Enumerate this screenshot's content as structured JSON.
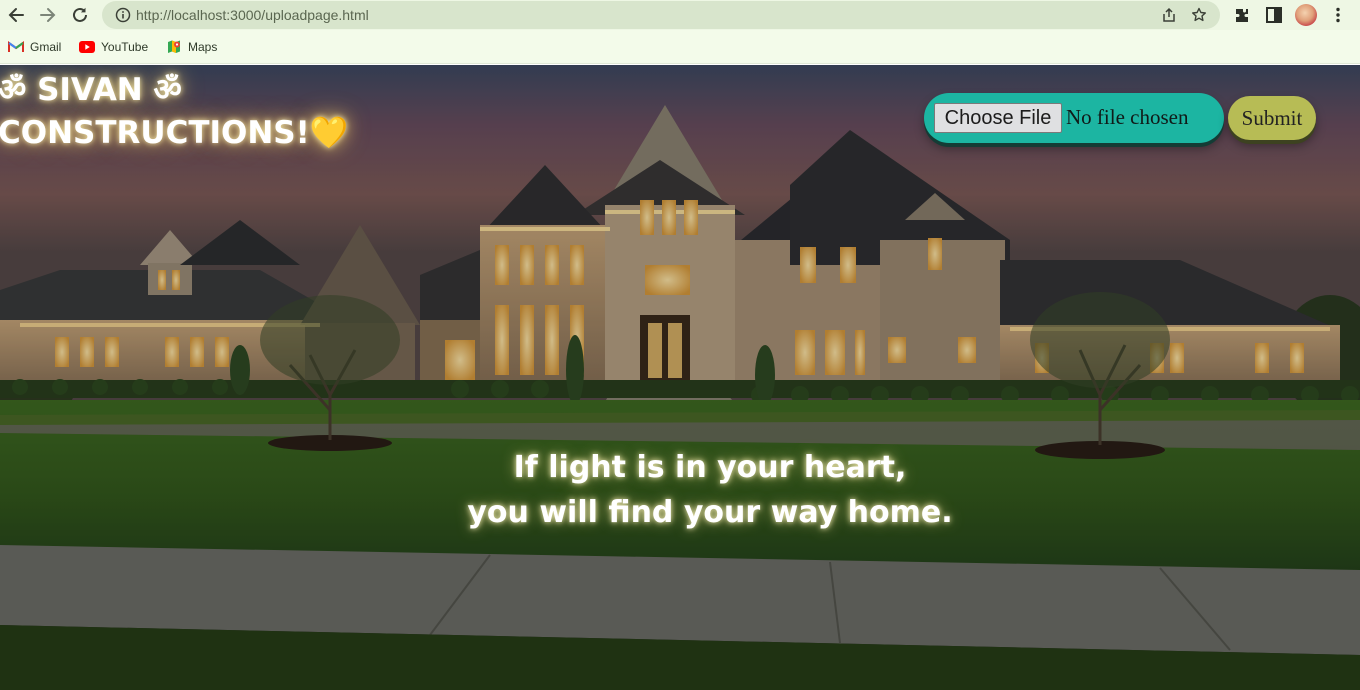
{
  "browser": {
    "url": "http://localhost:3000/uploadpage.html",
    "bookmarks": [
      {
        "label": "Gmail",
        "icon": "gmail-icon"
      },
      {
        "label": "YouTube",
        "icon": "youtube-icon"
      },
      {
        "label": "Maps",
        "icon": "maps-icon"
      }
    ]
  },
  "page": {
    "brand": {
      "line1": "ॐ SIVAN ॐ",
      "line2": "CONSTRUCTIONS!💛"
    },
    "upload": {
      "choose_label": "Choose File",
      "status": "No file chosen"
    },
    "submit_label": "Submit",
    "quote": {
      "line1": "If light is in your heart,",
      "line2": "you will find your way home."
    }
  },
  "colors": {
    "chrome": "#eef7e4",
    "upload_pill": "#1cb5a2",
    "submit_pill": "#b7bc55",
    "text_glow": "#ffe38a"
  }
}
